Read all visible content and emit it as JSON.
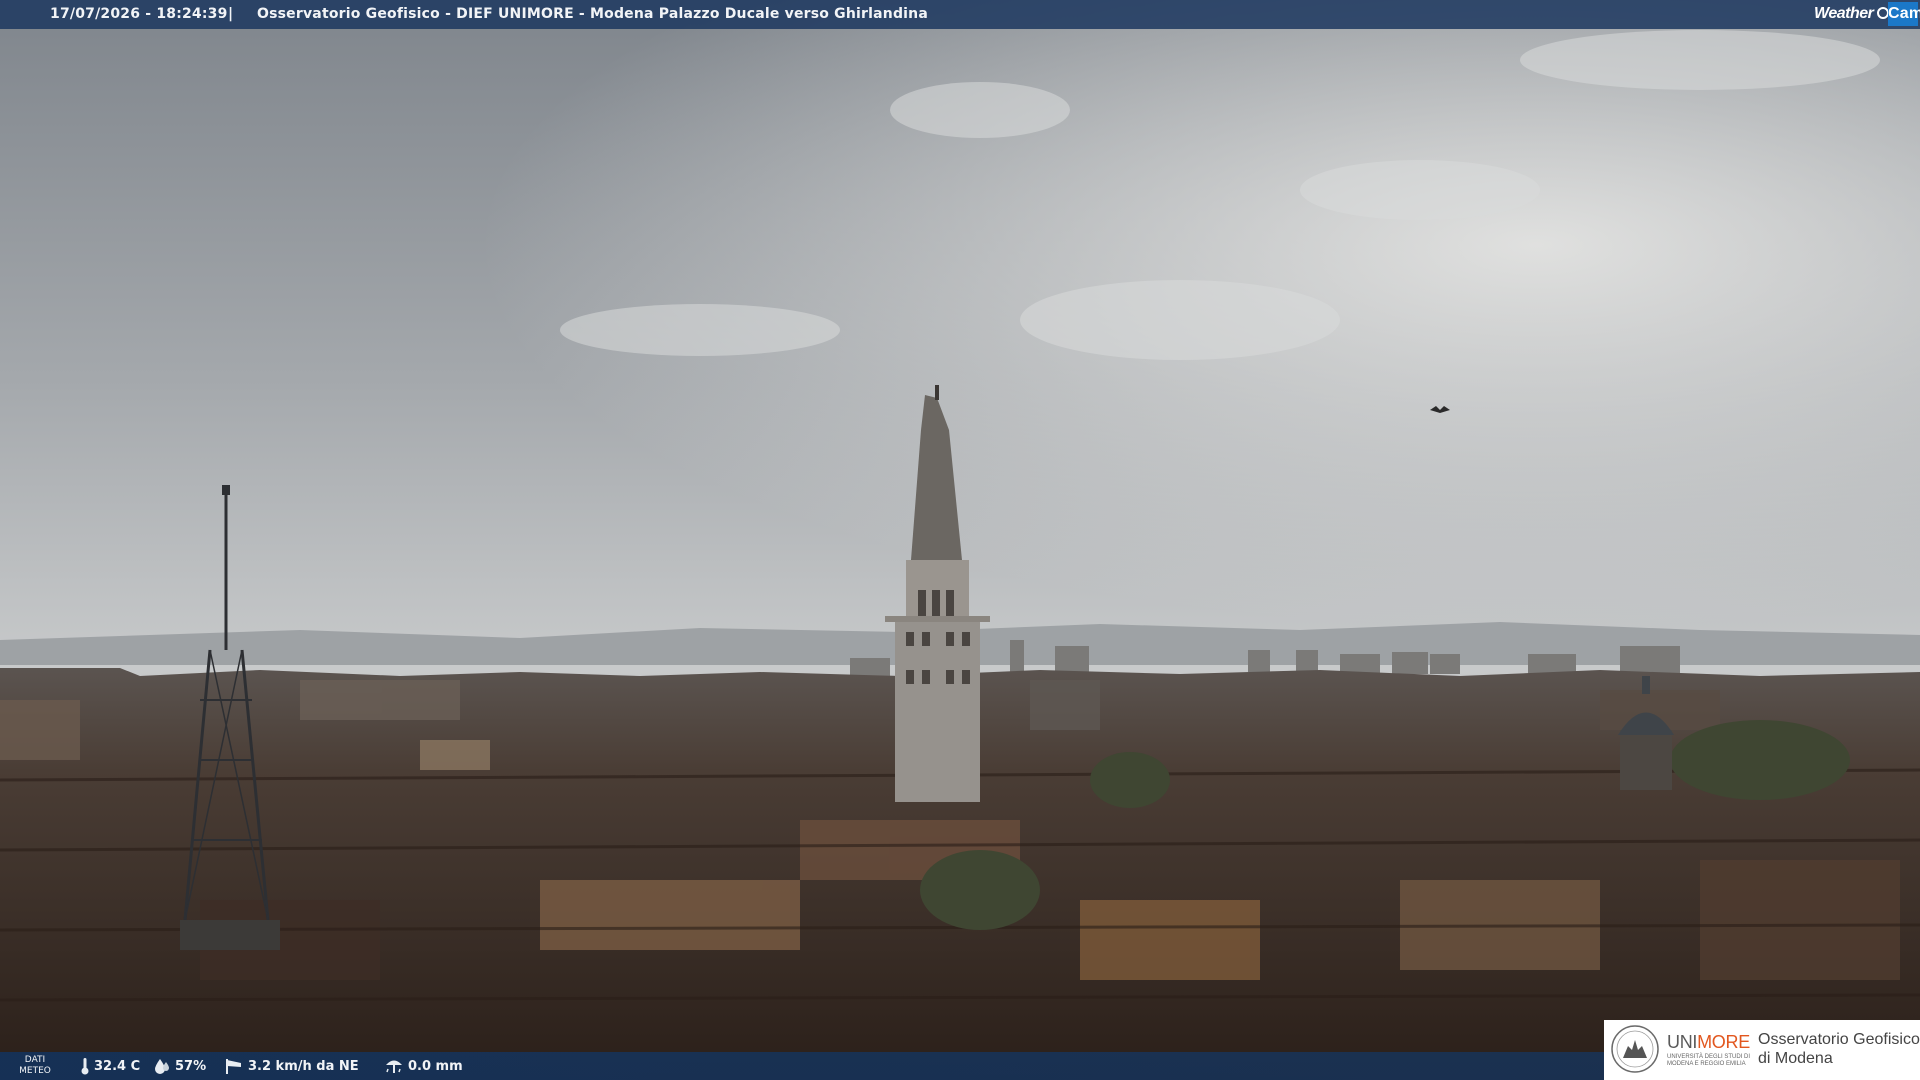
{
  "header": {
    "timestamp": "17/07/2026 - 18:24:39",
    "separator": "|",
    "camera_title": "Osservatorio Geofisico - DIEF UNIMORE - Modena Palazzo Ducale verso Ghirlandina",
    "logo": {
      "part1": "Weather",
      "part2": "Cam"
    }
  },
  "weather": {
    "label_line1": "DATI",
    "label_line2": "METEO",
    "temperature": "32.4 C",
    "humidity": "57%",
    "wind": "3.2 km/h da NE",
    "rain": "0.0 mm",
    "icons": [
      "thermometer-icon",
      "humidity-drop-icon",
      "wind-sock-icon",
      "rain-gauge-icon"
    ]
  },
  "branding": {
    "uni_part1": "UNI",
    "uni_part2": "MORE",
    "uni_subtitle": "Università degli Studi di Modena e Reggio Emilia",
    "org_line1": "Osservatorio Geofisico",
    "org_line2": "di Modena",
    "accent": "#e2571f"
  },
  "colors": {
    "bar": "#1c375f",
    "sky_top": "#8a8f95",
    "sky_horizon": "#c9cbcc",
    "roofs": "#3a2a22"
  }
}
